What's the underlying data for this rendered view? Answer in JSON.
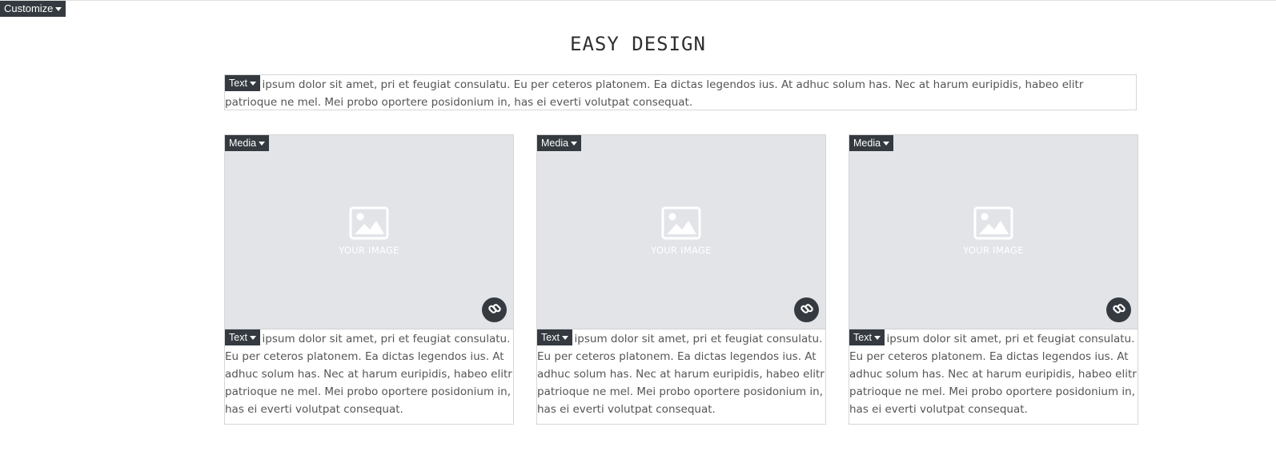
{
  "toolbar": {
    "customize_label": "Customize"
  },
  "page": {
    "title": "EASY DESIGN"
  },
  "intro": {
    "text_label": "Text",
    "paragraph": "Lorem ipsum dolor sit amet, pri et feugiat consulatu. Eu per ceteros platonem. Ea dictas legendos ius. At adhuc solum has. Nec at harum euripidis, habeo elitr patrioque ne mel. Mei probo oportere posidonium in, has ei everti volutpat consequat."
  },
  "cards": [
    {
      "media_label": "Media",
      "placeholder_label": "YOUR IMAGE",
      "text_label": "Text",
      "paragraph": "Lorem ipsum dolor sit amet, pri et feugiat consulatu. Eu per ceteros platonem. Ea dictas legendos ius. At adhuc solum has. Nec at harum euripidis, habeo elitr patrioque ne mel. Mei probo oportere posidonium in, has ei everti volutpat consequat."
    },
    {
      "media_label": "Media",
      "placeholder_label": "YOUR IMAGE",
      "text_label": "Text",
      "paragraph": "Lorem ipsum dolor sit amet, pri et feugiat consulatu. Eu per ceteros platonem. Ea dictas legendos ius. At adhuc solum has. Nec at harum euripidis, habeo elitr patrioque ne mel. Mei probo oportere posidonium in, has ei everti volutpat consequat."
    },
    {
      "media_label": "Media",
      "placeholder_label": "YOUR IMAGE",
      "text_label": "Text",
      "paragraph": "Lorem ipsum dolor sit amet, pri et feugiat consulatu. Eu per ceteros platonem. Ea dictas legendos ius. At adhuc solum has. Nec at harum euripidis, habeo elitr patrioque ne mel. Mei probo oportere posidonium in, has ei everti volutpat consequat."
    }
  ],
  "icons": {
    "caret": "caret-down-icon",
    "placeholder": "image-placeholder-icon",
    "link": "link-icon"
  },
  "colors": {
    "toolbar_bg": "#343a40",
    "placeholder_bg": "#e2e4e8",
    "text": "#555555"
  }
}
